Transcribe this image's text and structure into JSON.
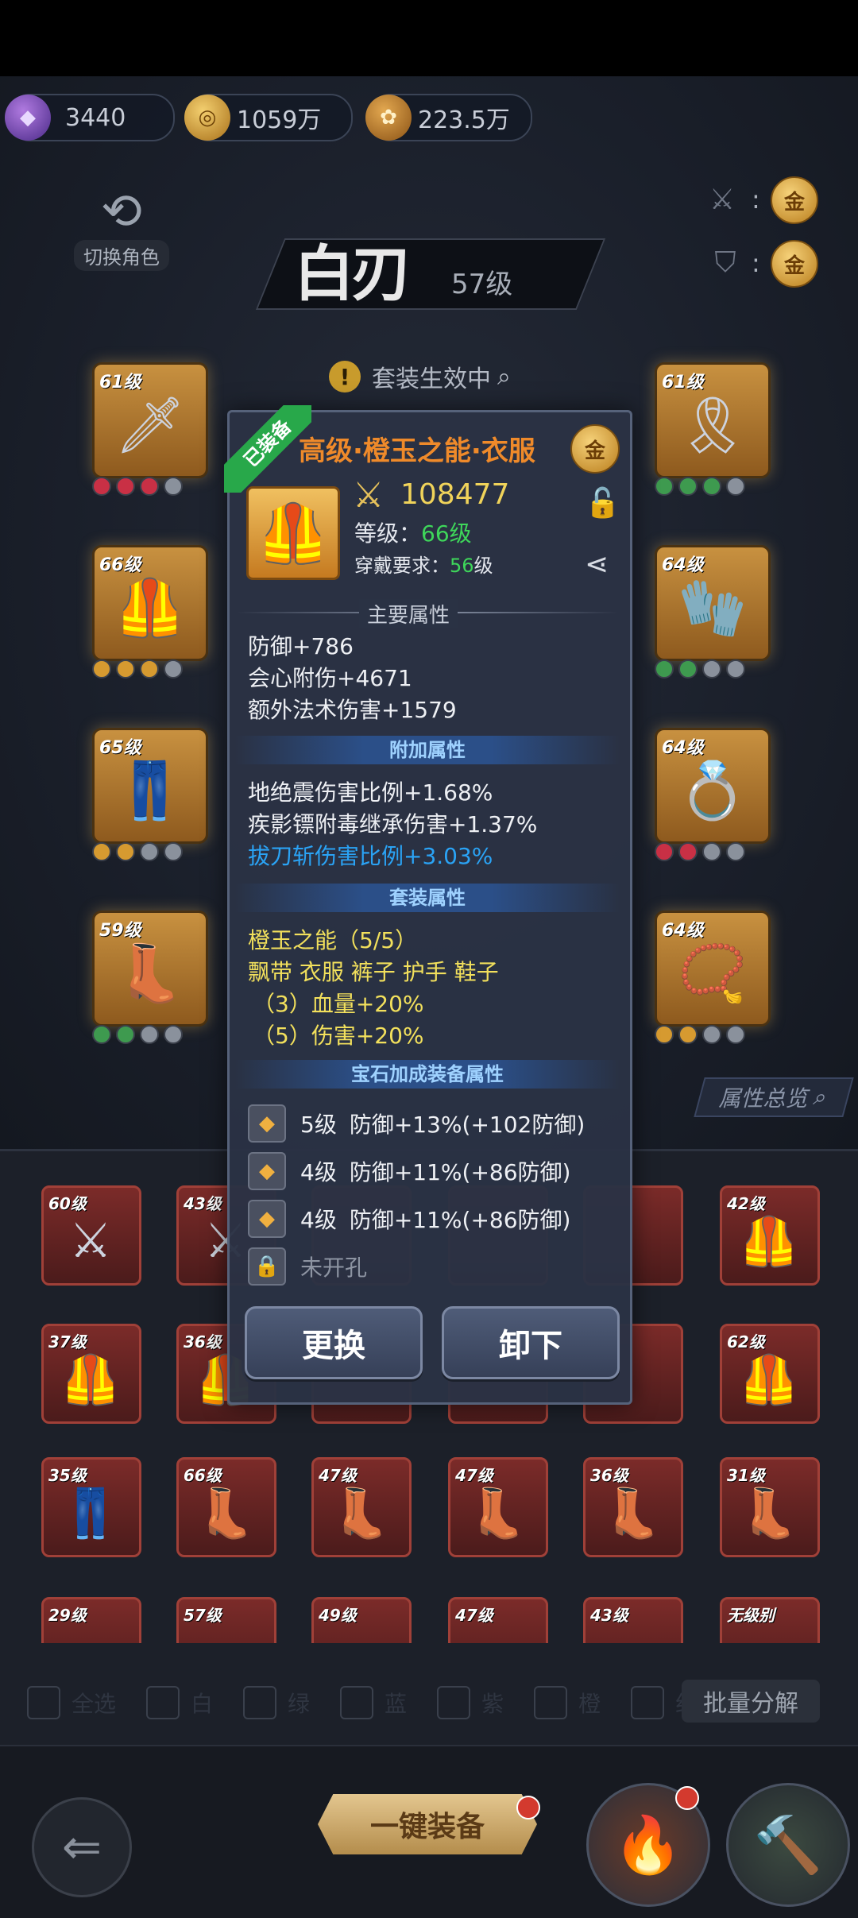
{
  "currency": {
    "gems": "3440",
    "gold": "1059万",
    "bag": "223.5万"
  },
  "header": {
    "switch_role": "切换角色",
    "char_name": "白刃",
    "char_level": "57级",
    "coin_label": "金",
    "set_effect": "套装生效中"
  },
  "left_slots": [
    {
      "level": "61级",
      "icon": "spear-icon"
    },
    {
      "level": "66级",
      "icon": "armor-icon"
    },
    {
      "level": "65级",
      "icon": "pants-icon"
    },
    {
      "level": "59级",
      "icon": "boots-icon"
    }
  ],
  "right_slots": [
    {
      "level": "61级",
      "icon": "ribbon-icon"
    },
    {
      "level": "64级",
      "icon": "gloves-icon"
    },
    {
      "level": "64级",
      "icon": "ring-icon"
    },
    {
      "level": "64级",
      "icon": "necklace-icon"
    }
  ],
  "overview_label": "属性总览",
  "bag_items": [
    [
      "60级",
      "43级",
      "",
      "",
      "",
      "42级"
    ],
    [
      "37级",
      "36级",
      "",
      "",
      "",
      "62级"
    ],
    [
      "35级",
      "66级",
      "47级",
      "47级",
      "36级",
      "31级"
    ],
    [
      "29级",
      "57级",
      "49级",
      "47级",
      "43级",
      "无级别"
    ]
  ],
  "filters": [
    "全选",
    "白",
    "绿",
    "蓝",
    "紫",
    "橙",
    "红"
  ],
  "batch_label": "批量分解",
  "one_key_label": "一键装备",
  "popup": {
    "equipped_tag": "已装备",
    "title": "高级·橙玉之能·衣服",
    "power": "108477",
    "level_label": "等级：",
    "level_value": "66级",
    "req_label": "穿戴要求：",
    "req_value": "56",
    "req_unit": "级",
    "main_attr_label": "主要属性",
    "main_attrs": [
      "防御+786",
      "会心附伤+4671",
      "额外法术伤害+1579"
    ],
    "extra_attr_label": "附加属性",
    "extra_attrs": [
      "地绝震伤害比例+1.68%",
      "疾影镖附毒继承伤害+1.37%"
    ],
    "extra_attr_blue": "拔刀斩伤害比例+3.03%",
    "set_attr_label": "套装属性",
    "set_name": "橙玉之能（5/5）",
    "set_pieces": "飘带 衣服 裤子 护手 鞋子",
    "set_bonus": [
      "（3）血量+20%",
      "（5）伤害+20%"
    ],
    "gem_attr_label": "宝石加成装备属性",
    "gems": [
      {
        "level": "5级",
        "text": "防御+13%(+102防御)"
      },
      {
        "level": "4级",
        "text": "防御+11%(+86防御)"
      },
      {
        "level": "4级",
        "text": "防御+11%(+86防御)"
      }
    ],
    "unopened": "未开孔",
    "replace_label": "更换",
    "unequip_label": "卸下"
  }
}
